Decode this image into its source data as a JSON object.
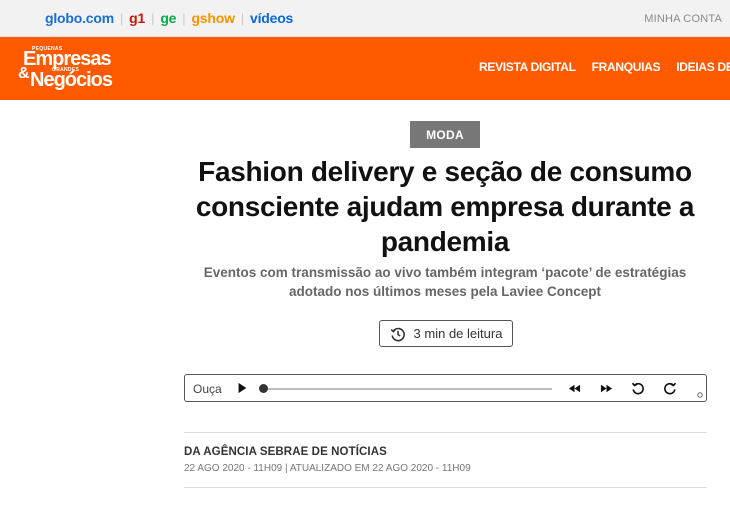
{
  "globo_bar": {
    "links": {
      "globo": "globo.com",
      "g1": "g1",
      "ge": "ge",
      "gshow": "gshow",
      "videos": "vídeos"
    },
    "separator": "|",
    "account": "MINHA CONTA",
    "colors": {
      "globo": "#1a6fd1",
      "g1": "#c4170c",
      "ge": "#06aa48",
      "gshow": "#fa9300",
      "videos": "#0669de"
    }
  },
  "header": {
    "background": "#ff5a00",
    "logo": {
      "top_small": "PEQUENAS",
      "line1": "Empresas",
      "ampersand": "&",
      "mid_small": "GRANDES",
      "line2": "Negócios"
    },
    "nav": [
      "REVISTA DIGITAL",
      "FRANQUIAS",
      "IDEIAS DE NEGÓCIOS"
    ]
  },
  "article": {
    "tag": "MODA",
    "title": "Fashion delivery e seção de consumo consciente ajudam empresa durante a pandemia",
    "subtitle": "Eventos com transmissão ao vivo também integram ‘pacote’ de estratégias adotado nos últimos meses pela Laviee Concept",
    "read_time": "3 min de leitura",
    "read_time_icon": "clock-icon"
  },
  "player": {
    "label": "Ouça",
    "progress": 0,
    "icons": [
      "play-icon",
      "rewind-icon",
      "fast-forward-icon",
      "undo-icon",
      "redo-icon"
    ]
  },
  "byline": {
    "author": "DA AGÊNCIA SEBRAE DE NOTÍCIAS",
    "dates": "22 AGO 2020 - 11H09 | ATUALIZADO EM 22 AGO 2020 - 11H09"
  }
}
